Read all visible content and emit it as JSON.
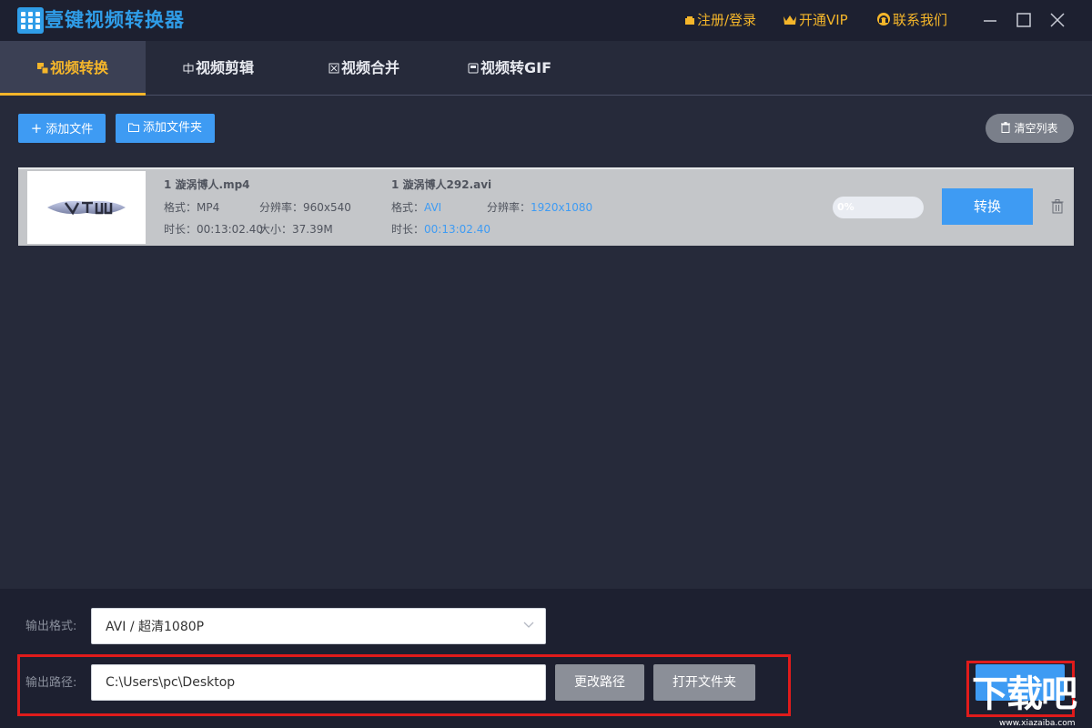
{
  "app": {
    "title": "壹键视频转换器"
  },
  "titlebar": {
    "register_login": "注册/登录",
    "vip": "开通VIP",
    "contact": "联系我们"
  },
  "tabs": [
    {
      "label": "视频转换",
      "active": true
    },
    {
      "label": "视频剪辑",
      "active": false
    },
    {
      "label": "视频合并",
      "active": false
    },
    {
      "label": "视频转GIF",
      "active": false
    }
  ],
  "toolbar": {
    "add_file": "添加文件",
    "add_folder": "添加文件夹",
    "clear_list": "清空列表"
  },
  "file": {
    "source": {
      "name": "1 漩涡博人.mp4",
      "format_label": "格式：",
      "format": "MP4",
      "resolution_label": "分辨率：",
      "resolution": "960x540",
      "duration_label": "时长：",
      "duration": "00:13:02.40",
      "size_label": "大小：",
      "size": "37.39M"
    },
    "target": {
      "name": "1 漩涡博人292.avi",
      "format_label": "格式：",
      "format": "AVI",
      "resolution_label": "分辨率：",
      "resolution": "1920x1080",
      "duration_label": "时长：",
      "duration": "00:13:02.40"
    },
    "progress": {
      "text": "0%",
      "value": 0
    },
    "convert_label": "转换"
  },
  "output": {
    "format_label": "输出格式:",
    "format_value": "AVI / 超清1080P",
    "path_label": "输出路径:",
    "path_value": "C:\\Users\\pc\\Desktop",
    "change_path": "更改路径",
    "open_folder": "打开文件夹"
  },
  "watermark": {
    "text": "下载吧",
    "url": "www.xiazaiba.com"
  },
  "colors": {
    "accent_blue": "#3e9bf3",
    "accent_gold": "#f5b62a",
    "highlight_red": "#e01b1b"
  }
}
